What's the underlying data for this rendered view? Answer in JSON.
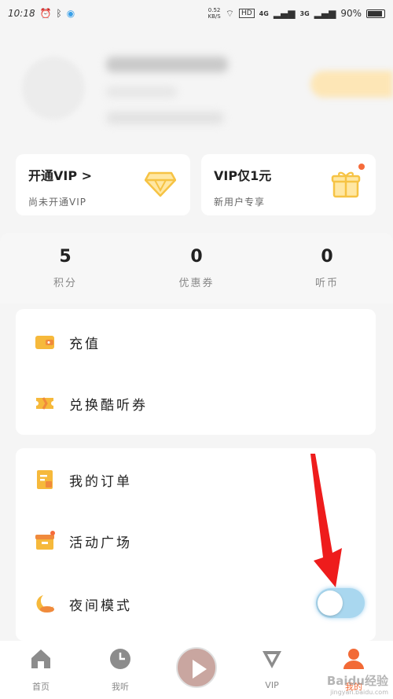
{
  "status_bar": {
    "time": "10:18",
    "speed_value": "0.52",
    "speed_unit": "KB/S",
    "hd": "HD",
    "net1": "4G",
    "net2": "3G",
    "battery": "90%"
  },
  "vip_cards": [
    {
      "title": "开通VIP >",
      "subtitle": "尚未开通VIP",
      "icon": "diamond-icon"
    },
    {
      "title": "VIP仅1元",
      "subtitle": "新用户专享",
      "icon": "gift-icon"
    }
  ],
  "stats": [
    {
      "value": "5",
      "label": "积分"
    },
    {
      "value": "0",
      "label": "优惠券"
    },
    {
      "value": "0",
      "label": "听币"
    }
  ],
  "menu_group1": [
    {
      "label": "充值",
      "icon": "wallet-icon"
    },
    {
      "label": "兑换酷听券",
      "icon": "ticket-icon"
    }
  ],
  "menu_group2": [
    {
      "label": "我的订单",
      "icon": "order-icon"
    },
    {
      "label": "活动广场",
      "icon": "event-icon"
    },
    {
      "label": "夜间模式",
      "icon": "moon-icon"
    }
  ],
  "night_mode_on": false,
  "tabs": [
    {
      "label": "首页",
      "icon": "home-icon"
    },
    {
      "label": "我听",
      "icon": "clock-icon"
    },
    {
      "label": "",
      "icon": "play-icon"
    },
    {
      "label": "VIP",
      "icon": "vip-icon"
    },
    {
      "label": "我的",
      "icon": "profile-icon"
    }
  ],
  "watermark": {
    "text": "Baidu经验",
    "sub": "jingyan.baidu.com"
  },
  "colors": {
    "accent": "#f26a36",
    "gold": "#f6c344",
    "toggle": "#a9d7ef",
    "arrow": "#ee1c1c"
  }
}
